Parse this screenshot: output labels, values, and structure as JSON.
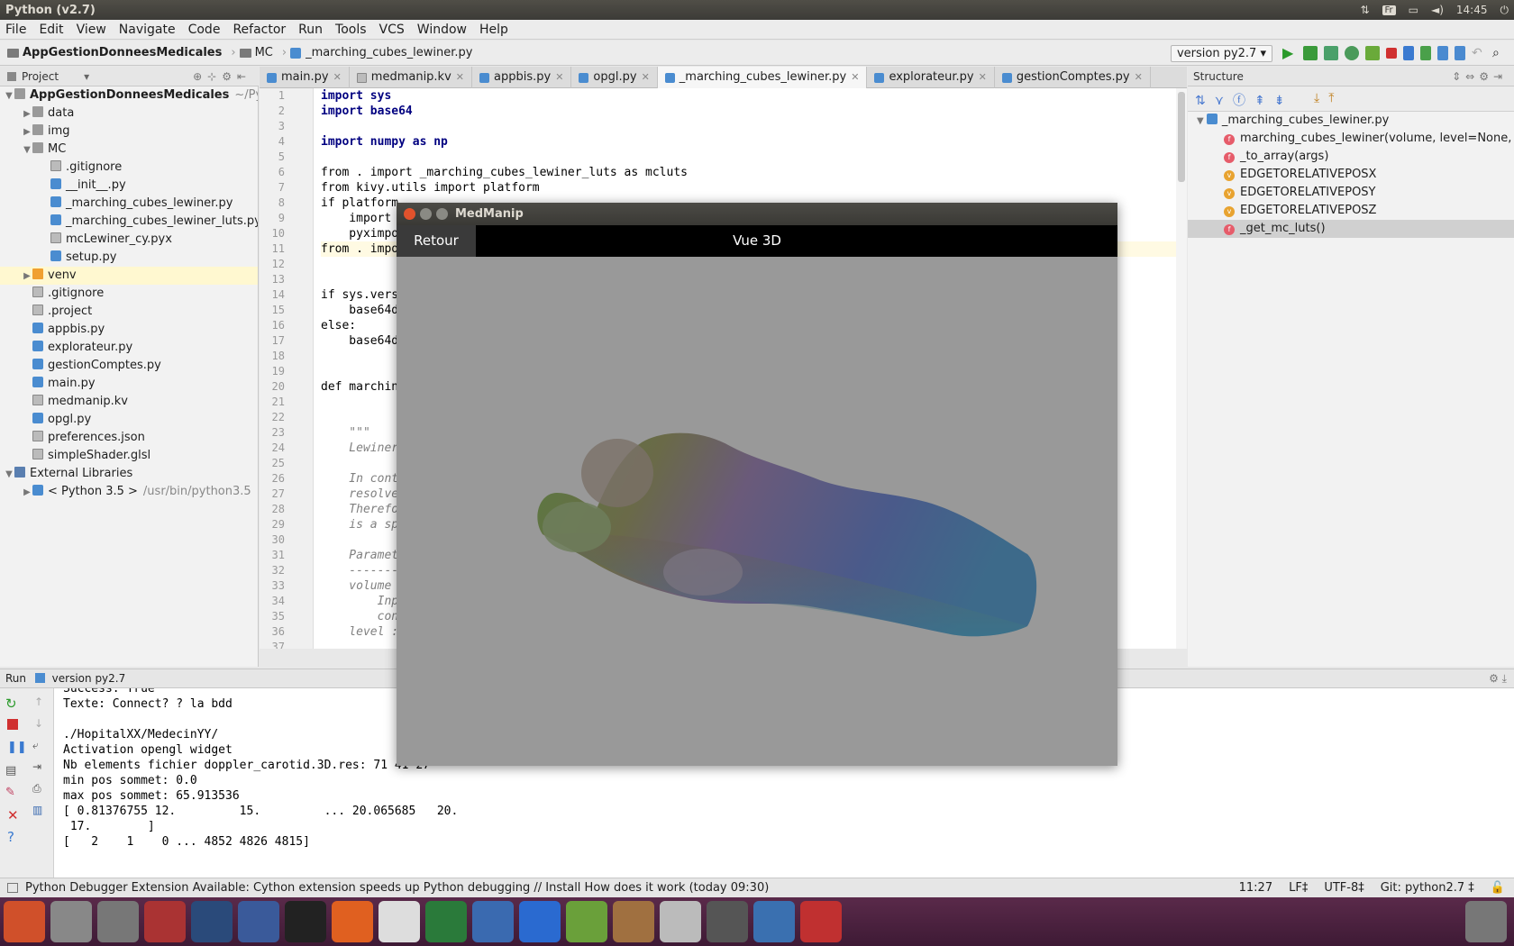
{
  "top": {
    "title": "Python (v2.7)",
    "keyboard": "Fr",
    "clock": "14:45"
  },
  "menu": [
    "File",
    "Edit",
    "View",
    "Navigate",
    "Code",
    "Refactor",
    "Run",
    "Tools",
    "VCS",
    "Window",
    "Help"
  ],
  "breadcrumb": {
    "project": "AppGestionDonneesMedicales",
    "folder": "MC",
    "file": "_marching_cubes_lewiner.py"
  },
  "run_config": "version py2.7",
  "project_panel": {
    "label": "Project",
    "items": [
      {
        "label": "AppGestionDonneesMedicales",
        "suffix": "~/Pycha",
        "indent": 0,
        "type": "folder",
        "arrow": "▼",
        "bold": true
      },
      {
        "label": "data",
        "indent": 1,
        "type": "folder",
        "arrow": "▶"
      },
      {
        "label": "img",
        "indent": 1,
        "type": "folder",
        "arrow": "▶"
      },
      {
        "label": "MC",
        "indent": 1,
        "type": "folder",
        "arrow": "▼"
      },
      {
        "label": ".gitignore",
        "indent": 2,
        "type": "file"
      },
      {
        "label": "__init__.py",
        "indent": 2,
        "type": "py"
      },
      {
        "label": "_marching_cubes_lewiner.py",
        "indent": 2,
        "type": "py"
      },
      {
        "label": "_marching_cubes_lewiner_luts.py",
        "indent": 2,
        "type": "py"
      },
      {
        "label": "mcLewiner_cy.pyx",
        "indent": 2,
        "type": "file"
      },
      {
        "label": "setup.py",
        "indent": 2,
        "type": "py"
      },
      {
        "label": "venv",
        "indent": 1,
        "type": "ofolder",
        "arrow": "▶",
        "selected": true
      },
      {
        "label": ".gitignore",
        "indent": 1,
        "type": "file"
      },
      {
        "label": ".project",
        "indent": 1,
        "type": "file"
      },
      {
        "label": "appbis.py",
        "indent": 1,
        "type": "py"
      },
      {
        "label": "explorateur.py",
        "indent": 1,
        "type": "py"
      },
      {
        "label": "gestionComptes.py",
        "indent": 1,
        "type": "py"
      },
      {
        "label": "main.py",
        "indent": 1,
        "type": "py"
      },
      {
        "label": "medmanip.kv",
        "indent": 1,
        "type": "file"
      },
      {
        "label": "opgl.py",
        "indent": 1,
        "type": "py"
      },
      {
        "label": "preferences.json",
        "indent": 1,
        "type": "file"
      },
      {
        "label": "simpleShader.glsl",
        "indent": 1,
        "type": "file"
      },
      {
        "label": "External Libraries",
        "indent": 0,
        "type": "lib",
        "arrow": "▼"
      },
      {
        "label": "< Python 3.5 >",
        "suffix": "/usr/bin/python3.5",
        "indent": 1,
        "type": "py",
        "arrow": "▶"
      }
    ]
  },
  "tabs": [
    {
      "label": "main.py"
    },
    {
      "label": "medmanip.kv"
    },
    {
      "label": "appbis.py"
    },
    {
      "label": "opgl.py"
    },
    {
      "label": "_marching_cubes_lewiner.py",
      "active": true
    },
    {
      "label": "explorateur.py"
    },
    {
      "label": "gestionComptes.py"
    }
  ],
  "code": [
    {
      "n": "1",
      "t": "import sys",
      "k": "kw"
    },
    {
      "n": "2",
      "t": "import base64",
      "k": "kw"
    },
    {
      "n": "3",
      "t": ""
    },
    {
      "n": "4",
      "t": "import numpy as np",
      "k": "kw"
    },
    {
      "n": "5",
      "t": ""
    },
    {
      "n": "6",
      "t": "from . import _marching_cubes_lewiner_luts as mcluts"
    },
    {
      "n": "7",
      "t": "from kivy.utils import platform"
    },
    {
      "n": "8",
      "t": "if platform"
    },
    {
      "n": "9",
      "t": "    import"
    },
    {
      "n": "10",
      "t": "    pyximpo"
    },
    {
      "n": "11",
      "t": "from . impo",
      "hl": true
    },
    {
      "n": "12",
      "t": ""
    },
    {
      "n": "13",
      "t": ""
    },
    {
      "n": "14",
      "t": "if sys.vers"
    },
    {
      "n": "15",
      "t": "    base64d"
    },
    {
      "n": "16",
      "t": "else:"
    },
    {
      "n": "17",
      "t": "    base64d"
    },
    {
      "n": "18",
      "t": ""
    },
    {
      "n": "19",
      "t": ""
    },
    {
      "n": "20",
      "t": "def marchin"
    },
    {
      "n": "21",
      "t": ""
    },
    {
      "n": "22",
      "t": ""
    },
    {
      "n": "23",
      "t": "    \"\"\"",
      "k": "doc"
    },
    {
      "n": "24",
      "t": "    Lewiner",
      "k": "doc"
    },
    {
      "n": "25",
      "t": ""
    },
    {
      "n": "26",
      "t": "    In cont",
      "k": "doc"
    },
    {
      "n": "27",
      "t": "    resolve",
      "k": "doc"
    },
    {
      "n": "28",
      "t": "    Therefo",
      "k": "doc"
    },
    {
      "n": "29",
      "t": "    is a sp",
      "k": "doc"
    },
    {
      "n": "30",
      "t": ""
    },
    {
      "n": "31",
      "t": "    Paramet",
      "k": "doc"
    },
    {
      "n": "32",
      "t": "    -------",
      "k": "doc"
    },
    {
      "n": "33",
      "t": "    volume",
      "k": "doc"
    },
    {
      "n": "34",
      "t": "        Inp",
      "k": "doc"
    },
    {
      "n": "35",
      "t": "        con",
      "k": "doc"
    },
    {
      "n": "36",
      "t": "    level :",
      "k": "doc"
    },
    {
      "n": "37",
      "t": ""
    }
  ],
  "structure": {
    "label": "Structure",
    "items": [
      {
        "label": "_marching_cubes_lewiner.py",
        "badge": "",
        "root": true
      },
      {
        "label": "marching_cubes_lewiner(volume, level=None, spaci",
        "badge": "f"
      },
      {
        "label": "_to_array(args)",
        "badge": "f"
      },
      {
        "label": "EDGETORELATIVEPOSX",
        "badge": "v"
      },
      {
        "label": "EDGETORELATIVEPOSY",
        "badge": "v"
      },
      {
        "label": "EDGETORELATIVEPOSZ",
        "badge": "v"
      },
      {
        "label": "_get_mc_luts()",
        "badge": "f",
        "selected": true
      }
    ]
  },
  "run": {
    "label": "Run",
    "config": "version py2.7",
    "output": [
      "Success: True",
      "Texte: Connect? ? la bdd",
      "",
      "./HopitalXX/MedecinYY/",
      "Activation opengl widget",
      "Nb elements fichier doppler_carotid.3D.res: 71 41 27",
      "min pos sommet: 0.0",
      "max pos sommet: 65.913536",
      "[ 0.81376755 12.         15.         ... 20.065685   20.",
      " 17.        ]",
      "[   2    1    0 ... 4852 4826 4815]"
    ]
  },
  "status": {
    "message": "Python Debugger Extension Available: Cython extension speeds up Python debugging // Install How does it work (today 09:30)",
    "position": "11:27",
    "line_sep": "LF‡",
    "encoding": "UTF-8‡",
    "git": "Git: python2.7 ‡"
  },
  "window": {
    "title": "MedManip",
    "back_button": "Retour",
    "view_title": "Vue 3D"
  },
  "launcher": [
    "ubuntu",
    "disks",
    "files",
    "settings",
    "remote",
    "browser-globe",
    "terminal",
    "firefox",
    "text-editor",
    "pycharm",
    "image-viewer",
    "wxhex",
    "hex-game",
    "archive",
    "gedit",
    "software-updater",
    "python",
    "chart"
  ]
}
